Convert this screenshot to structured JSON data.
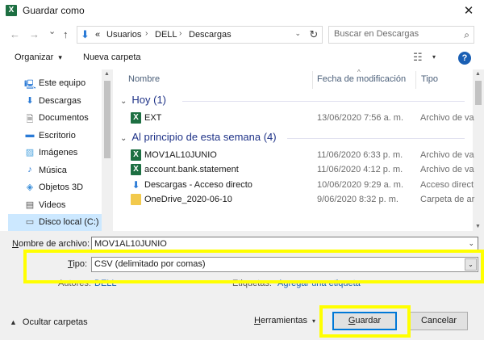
{
  "window": {
    "app_icon": "excel-icon",
    "title": "Guardar como",
    "close_glyph": "✕"
  },
  "address": {
    "back_glyph": "←",
    "forward_glyph": "→",
    "history_glyph": "⌄",
    "up_glyph": "↑",
    "overflow": "«",
    "crumbs": [
      "Usuarios",
      "DELL",
      "Descargas"
    ],
    "separator": "›",
    "dropdown_glyph": "⌄",
    "refresh_glyph": "↻"
  },
  "search": {
    "placeholder": "Buscar en Descargas",
    "icon": "search-icon"
  },
  "toolbar": {
    "organize": "Organizar",
    "organize_dd": "▾",
    "new_folder": "Nueva carpeta",
    "view_icon": "☷",
    "view_dd": "▾",
    "help": "?"
  },
  "nav": {
    "items": [
      {
        "label": "Este equipo",
        "icon": "computer-icon",
        "glyph": "🖳",
        "color": "#2a7ad6"
      },
      {
        "label": "Descargas",
        "icon": "download-icon",
        "glyph": "⬇",
        "color": "#2a7ad6"
      },
      {
        "label": "Documentos",
        "icon": "documents-icon",
        "glyph": "🗎",
        "color": "#6a6a6a"
      },
      {
        "label": "Escritorio",
        "icon": "desktop-icon",
        "glyph": "▬",
        "color": "#2a7ad6"
      },
      {
        "label": "Imágenes",
        "icon": "pictures-icon",
        "glyph": "▨",
        "color": "#4aa3df"
      },
      {
        "label": "Música",
        "icon": "music-icon",
        "glyph": "♪",
        "color": "#2a7ad6"
      },
      {
        "label": "Objetos 3D",
        "icon": "objects-3d-icon",
        "glyph": "◈",
        "color": "#3b8fd9"
      },
      {
        "label": "Videos",
        "icon": "videos-icon",
        "glyph": "▤",
        "color": "#555555"
      },
      {
        "label": "Disco local (C:)",
        "icon": "drive-icon",
        "glyph": "▭",
        "color": "#555555"
      }
    ],
    "selected_index": 8
  },
  "files": {
    "columns": {
      "name": "Nombre",
      "date": "Fecha de modificación",
      "type": "Tipo"
    },
    "sort_glyph": "^",
    "groups": [
      {
        "title": "Hoy (1)",
        "rows": [
          {
            "name": "EXT",
            "date": "13/06/2020 7:56 a. m.",
            "type": "Archivo de va",
            "icon": "excel-file-icon"
          }
        ]
      },
      {
        "title": "Al principio de esta semana (4)",
        "rows": [
          {
            "name": "MOV1AL10JUNIO",
            "date": "11/06/2020 6:33 p. m.",
            "type": "Archivo de va",
            "icon": "excel-file-icon"
          },
          {
            "name": "account.bank.statement",
            "date": "11/06/2020 4:12 p. m.",
            "type": "Archivo de va",
            "icon": "excel-file-icon"
          },
          {
            "name": "Descargas - Acceso directo",
            "date": "10/06/2020 9:29 a. m.",
            "type": "Acceso direct",
            "icon": "shortcut-icon"
          },
          {
            "name": "OneDrive_2020-06-10",
            "date": "9/06/2020 8:32 p. m.",
            "type": "Carpeta de ar",
            "icon": "folder-icon"
          }
        ]
      }
    ],
    "collapse_glyph": "⌄"
  },
  "form": {
    "filename_label_u": "N",
    "filename_label_rest": "ombre de archivo:",
    "filename_value": "MOV1AL10JUNIO",
    "type_label_u": "T",
    "type_label_rest": "ipo:",
    "type_value": "CSV (delimitado por comas)",
    "authors_label": "Autores:",
    "authors_value": "DELL",
    "tags_label": "Etiquetas:",
    "tags_value": "Agregar una etiqueta",
    "highlight_color": "#ffff00"
  },
  "footer": {
    "hide_folders": "Ocultar carpetas",
    "hide_glyph": "▲",
    "tools_u": "H",
    "tools_rest": "erramientas",
    "tools_dd": "▾",
    "save_u": "G",
    "save_rest": "uardar",
    "cancel": "Cancelar"
  }
}
